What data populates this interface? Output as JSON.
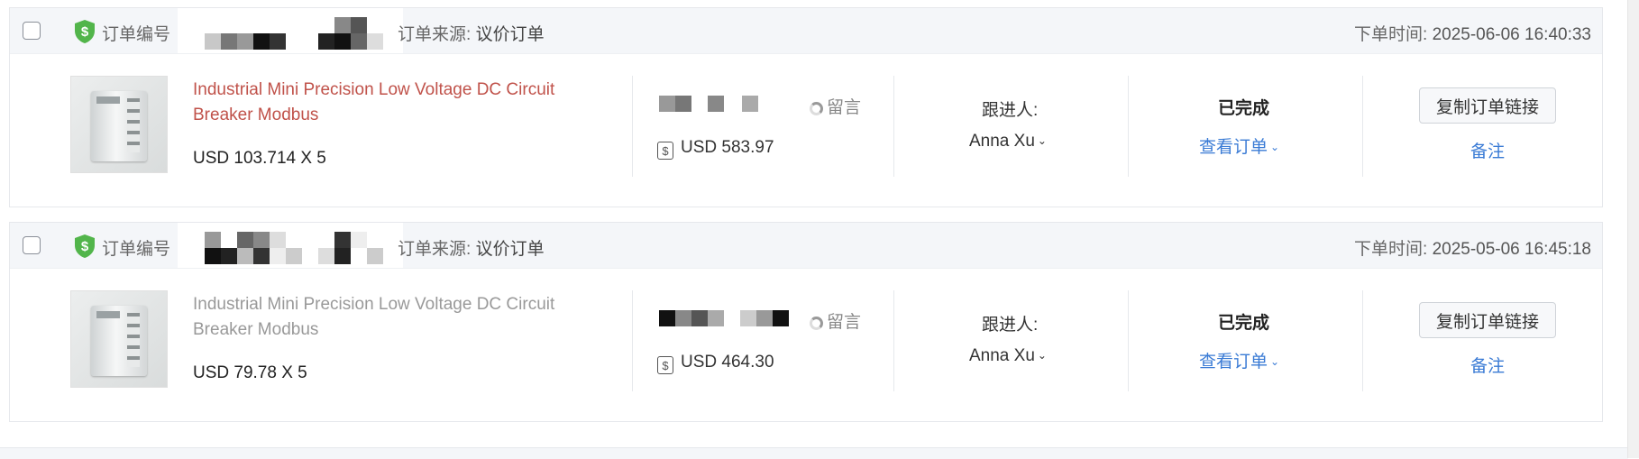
{
  "labels": {
    "order_no": "订单编号",
    "source_prefix": "订单来源:",
    "time_prefix": "下单时间:",
    "message": "留言",
    "follow": "跟进人:",
    "view_order": "查看订单",
    "copy_link": "复制订单链接",
    "remark": "备注"
  },
  "colors": {
    "title_active": "#c0524a",
    "title_muted": "#999999",
    "link": "#3a7bd5",
    "shield": "#52b54b"
  },
  "orders": [
    {
      "source": "议价订单",
      "order_time": "2025-06-06 16:40:33",
      "product_title": "Industrial Mini Precision Low Voltage DC Circuit Breaker Modbus",
      "unit_price": "USD 103.714 X 5",
      "total": "USD 583.97",
      "follower": "Anna Xu",
      "status": "已完成"
    },
    {
      "source": "议价订单",
      "order_time": "2025-05-06 16:45:18",
      "product_title": "Industrial Mini Precision Low Voltage DC Circuit Breaker Modbus",
      "unit_price": "USD 79.78 X 5",
      "total": "USD 464.30",
      "follower": "Anna Xu",
      "status": "已完成"
    }
  ]
}
